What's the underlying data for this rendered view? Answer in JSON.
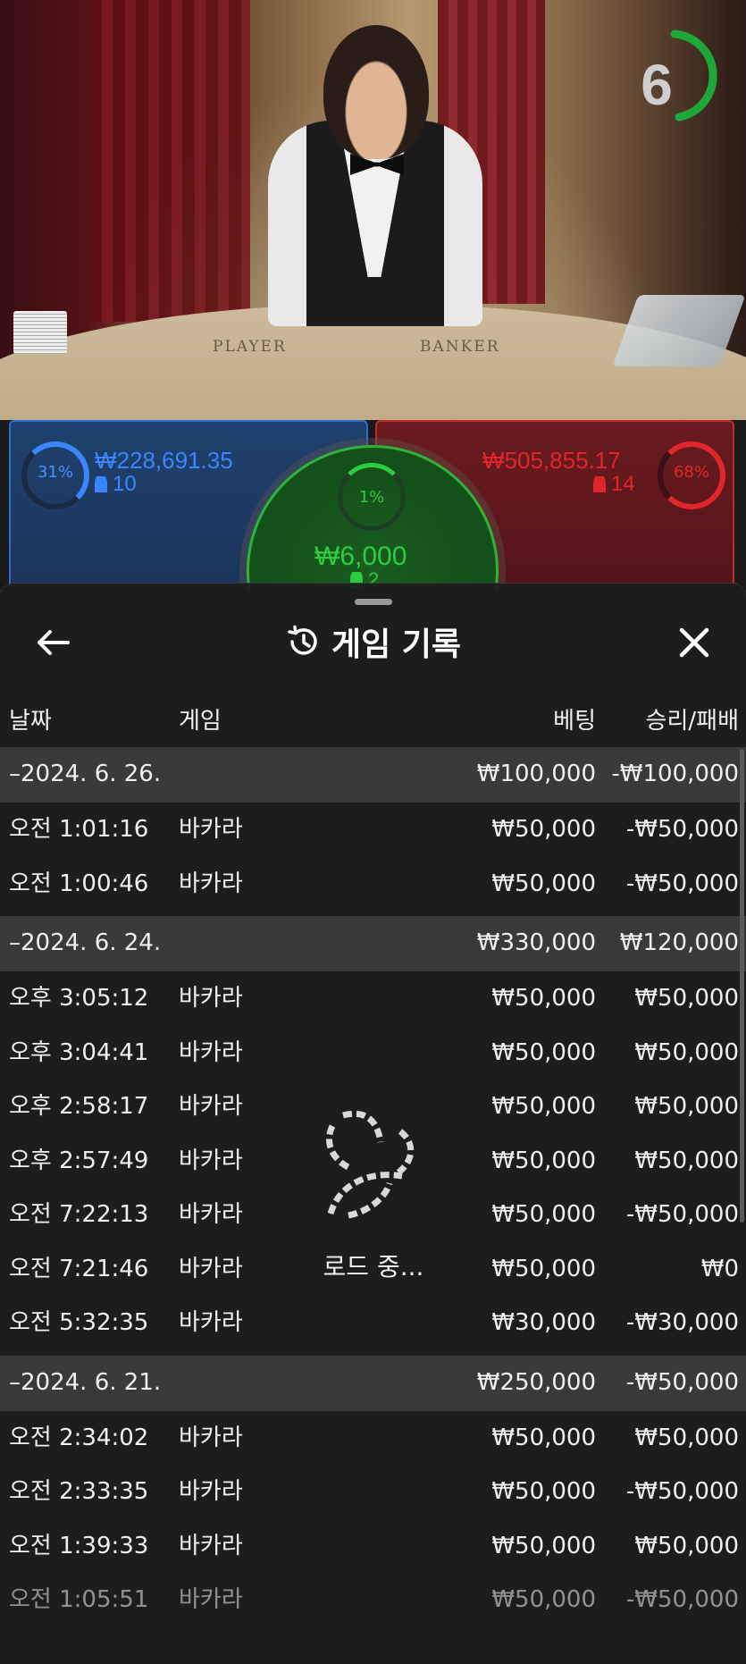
{
  "video": {
    "table_labels": [
      "PLAYER",
      "BANKER"
    ],
    "timer": "6"
  },
  "bets": {
    "player": {
      "percent": "31%",
      "amount": "₩228,691.35",
      "count": "10"
    },
    "tie": {
      "percent": "1%",
      "amount": "₩6,000",
      "count": "2"
    },
    "banker": {
      "percent": "68%",
      "amount": "₩505,855.17",
      "count": "14"
    }
  },
  "sheet": {
    "title": "게임 기록",
    "columns": {
      "date": "날짜",
      "game": "게임",
      "bet": "베팅",
      "win_loss": "승리/패배"
    },
    "loading_text": "로드 중..."
  },
  "rows": [
    {
      "type": "group",
      "date": "–2024. 6. 26.",
      "bet": "₩100,000",
      "win_loss": "-₩100,000"
    },
    {
      "type": "item",
      "date": "오전 1:01:16",
      "game": "바카라",
      "bet": "₩50,000",
      "win_loss": "-₩50,000"
    },
    {
      "type": "item",
      "date": "오전 1:00:46",
      "game": "바카라",
      "bet": "₩50,000",
      "win_loss": "-₩50,000"
    },
    {
      "type": "group",
      "date": "–2024. 6. 24.",
      "bet": "₩330,000",
      "win_loss": "₩120,000"
    },
    {
      "type": "item",
      "date": "오후 3:05:12",
      "game": "바카라",
      "bet": "₩50,000",
      "win_loss": "₩50,000"
    },
    {
      "type": "item",
      "date": "오후 3:04:41",
      "game": "바카라",
      "bet": "₩50,000",
      "win_loss": "₩50,000"
    },
    {
      "type": "item",
      "date": "오후 2:58:17",
      "game": "바카라",
      "bet": "₩50,000",
      "win_loss": "₩50,000"
    },
    {
      "type": "item",
      "date": "오후 2:57:49",
      "game": "바카라",
      "bet": "₩50,000",
      "win_loss": "₩50,000"
    },
    {
      "type": "item",
      "date": "오전 7:22:13",
      "game": "바카라",
      "bet": "₩50,000",
      "win_loss": "-₩50,000"
    },
    {
      "type": "item",
      "date": "오전 7:21:46",
      "game": "바카라",
      "bet": "₩50,000",
      "win_loss": "₩0"
    },
    {
      "type": "item",
      "date": "오전 5:32:35",
      "game": "바카라",
      "bet": "₩30,000",
      "win_loss": "-₩30,000"
    },
    {
      "type": "group",
      "date": "–2024. 6. 21.",
      "bet": "₩250,000",
      "win_loss": "-₩50,000"
    },
    {
      "type": "item",
      "date": "오전 2:34:02",
      "game": "바카라",
      "bet": "₩50,000",
      "win_loss": "₩50,000"
    },
    {
      "type": "item",
      "date": "오전 2:33:35",
      "game": "바카라",
      "bet": "₩50,000",
      "win_loss": "-₩50,000"
    },
    {
      "type": "item",
      "date": "오전 1:39:33",
      "game": "바카라",
      "bet": "₩50,000",
      "win_loss": "₩50,000"
    },
    {
      "type": "item",
      "date": "오전 1:05:51",
      "game": "바카라",
      "bet": "₩50,000",
      "win_loss": "-₩50,000"
    }
  ],
  "colors": {
    "player": "#3a86ff",
    "banker": "#e1262b",
    "tie": "#2ecc40",
    "sheet_bg": "#1c1c1c",
    "group_row": "#3a3a3a"
  },
  "icons": {
    "back": "arrow-left-icon",
    "history": "history-icon",
    "close": "close-icon",
    "loader": "loading-spinner-icon"
  }
}
